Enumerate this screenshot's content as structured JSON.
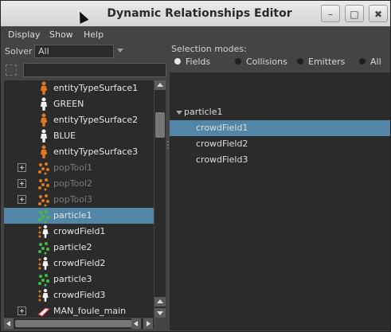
{
  "window": {
    "title": "Dynamic Relationships Editor"
  },
  "titlebar_buttons": {
    "minimize": "–",
    "maximize": "□",
    "close": "✖"
  },
  "menu": {
    "display": "Display",
    "show": "Show",
    "help": "Help"
  },
  "solver": {
    "label": "Solver",
    "value": "All"
  },
  "left_tree": {
    "items": [
      {
        "label": "entityTypeSurface1",
        "icon": "person-orange-icon",
        "expandable": false,
        "dim": false,
        "selected": false
      },
      {
        "label": "GREEN",
        "icon": "person-white-icon",
        "expandable": false,
        "dim": false,
        "selected": false
      },
      {
        "label": "entityTypeSurface2",
        "icon": "person-orange-icon",
        "expandable": false,
        "dim": false,
        "selected": false
      },
      {
        "label": "BLUE",
        "icon": "person-white-icon",
        "expandable": false,
        "dim": false,
        "selected": false
      },
      {
        "label": "entityTypeSurface3",
        "icon": "person-orange-icon",
        "expandable": false,
        "dim": false,
        "selected": false
      },
      {
        "label": "popTool1",
        "icon": "particles-orange-icon",
        "expandable": true,
        "dim": true,
        "selected": false
      },
      {
        "label": "popTool2",
        "icon": "particles-orange-icon",
        "expandable": true,
        "dim": true,
        "selected": false
      },
      {
        "label": "popTool3",
        "icon": "particles-orange-icon",
        "expandable": true,
        "dim": true,
        "selected": false
      },
      {
        "label": "particle1",
        "icon": "particles-green-icon",
        "expandable": false,
        "dim": false,
        "selected": true
      },
      {
        "label": "crowdField1",
        "icon": "crowd-field-icon",
        "expandable": false,
        "dim": false,
        "selected": false
      },
      {
        "label": "particle2",
        "icon": "particles-green-icon",
        "expandable": false,
        "dim": false,
        "selected": false
      },
      {
        "label": "crowdField2",
        "icon": "crowd-field-icon",
        "expandable": false,
        "dim": false,
        "selected": false
      },
      {
        "label": "particle3",
        "icon": "particles-green-icon",
        "expandable": false,
        "dim": false,
        "selected": false
      },
      {
        "label": "crowdField3",
        "icon": "crowd-field-icon",
        "expandable": false,
        "dim": false,
        "selected": false
      },
      {
        "label": "MAN_foule_main",
        "icon": "mesh-icon",
        "expandable": true,
        "dim": false,
        "selected": false
      }
    ]
  },
  "selection_modes": {
    "title": "Selection modes:",
    "options": [
      {
        "label": "Fields",
        "checked": true
      },
      {
        "label": "Collisions",
        "checked": false
      },
      {
        "label": "Emitters",
        "checked": false
      },
      {
        "label": "All",
        "checked": false
      }
    ]
  },
  "right_tree": {
    "parent": "particle1",
    "children": [
      {
        "label": "crowdField1",
        "selected": true
      },
      {
        "label": "crowdField2",
        "selected": false
      },
      {
        "label": "crowdField3",
        "selected": false
      }
    ]
  },
  "colors": {
    "selection": "#5285a6",
    "panel": "#2b2b2b",
    "window": "#444444",
    "orange_icon": "#e0781e",
    "green_icon": "#3fbf3f"
  }
}
